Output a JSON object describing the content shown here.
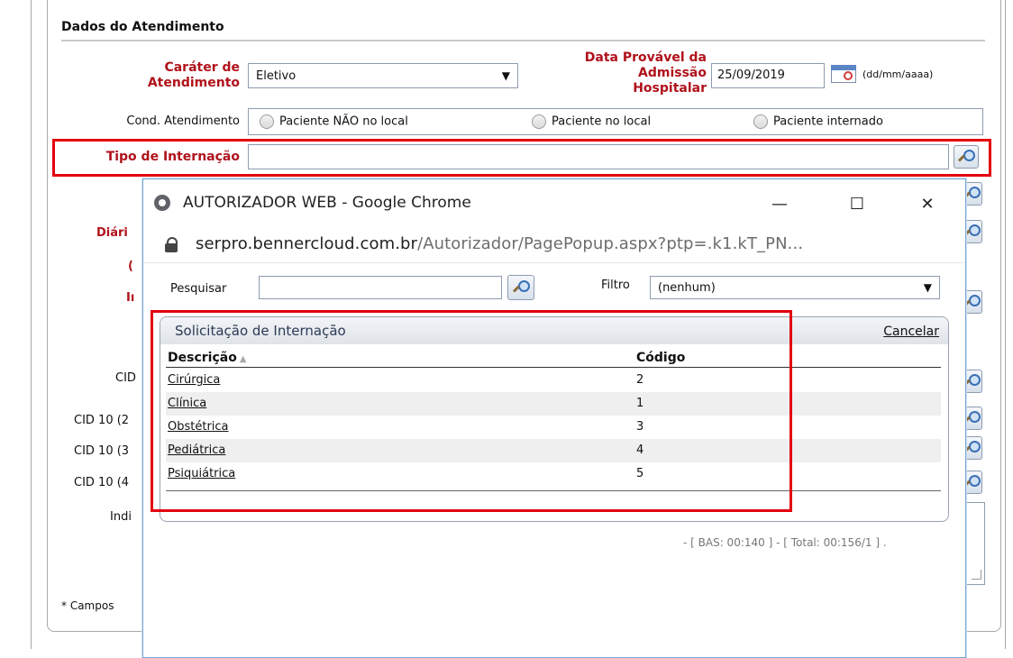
{
  "section": {
    "title": "Dados do Atendimento"
  },
  "carater": {
    "label_line1": "Caráter de",
    "label_line2": "Atendimento",
    "value": "Eletivo"
  },
  "data_admissao": {
    "label_line1": "Data Provável da",
    "label_line2": "Admissão",
    "label_line3": "Hospitalar",
    "value": "25/09/2019",
    "hint": "(dd/mm/aaaa)"
  },
  "cond": {
    "label": "Cond. Atendimento",
    "options": [
      "Paciente NÃO no local",
      "Paciente no local",
      "Paciente internado"
    ]
  },
  "tipo_internacao": {
    "label": "Tipo de Internação",
    "value": ""
  },
  "hidden_labels": {
    "diaria": "Diári",
    "letter_c": "(",
    "letter_i": "Iı",
    "cid1": "CID",
    "cid2": "CID 10 (2",
    "cid3": "CID 10 (3",
    "cid4": "CID 10 (4",
    "indi": "Indi",
    "campos": "* Campos"
  },
  "popup": {
    "window_title": "AUTORIZADOR WEB - Google Chrome",
    "controls": {
      "minimize": "—",
      "maximize": "☐",
      "close": "✕"
    },
    "url_host": "serpro.bennercloud.com.br",
    "url_path": "/Autorizador/PagePopup.aspx?ptp=.k1.kT_PN...",
    "search": {
      "label": "Pesquisar",
      "value": ""
    },
    "filter": {
      "label": "Filtro",
      "value": "(nenhum)"
    },
    "grid": {
      "title": "Solicitação de Internação",
      "cancel": "Cancelar",
      "col_desc": "Descrição",
      "col_code": "Código",
      "rows": [
        {
          "desc": "Cirúrgica",
          "code": "2"
        },
        {
          "desc": "Clínica",
          "code": "1"
        },
        {
          "desc": "Obstétrica",
          "code": "3"
        },
        {
          "desc": "Pediátrica",
          "code": "4"
        },
        {
          "desc": "Psiquiátrica",
          "code": "5"
        }
      ]
    },
    "status": "- [ BAS: 00:140 ] - [ Total: 00:156/1 ] ."
  },
  "colors": {
    "required_label": "#b0121b",
    "highlight": "#e3000f",
    "field_border": "#8e9bb0"
  }
}
